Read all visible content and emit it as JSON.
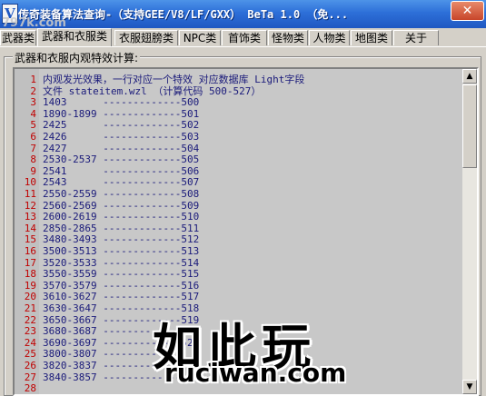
{
  "window": {
    "title": "传奇装备算法查询-（支持GEE/V8/LF/GXX）        BeTa 1.0 （免...",
    "close_label": "✕",
    "app_icon_letter": "V"
  },
  "tabs": [
    {
      "label": "武器类"
    },
    {
      "label": "武器和衣服类"
    },
    {
      "label": "衣服翅膀类"
    },
    {
      "label": "NPC类"
    },
    {
      "label": "首饰类"
    },
    {
      "label": "怪物类"
    },
    {
      "label": "人物类"
    },
    {
      "label": "地图类"
    },
    {
      "label": "关于"
    }
  ],
  "group": {
    "label": "武器和衣服内观特效计算:"
  },
  "editor": {
    "lines": [
      {
        "num": "1",
        "text": "内观发光效果，一行对应一个特效 对应数据库 Light字段"
      },
      {
        "num": "2",
        "text": "文件 stateitem.wzl （计算代码 500-527）"
      },
      {
        "num": "3",
        "text": "1403      -------------500"
      },
      {
        "num": "4",
        "text": "1890-1899 -------------501"
      },
      {
        "num": "5",
        "text": "2425      -------------502"
      },
      {
        "num": "6",
        "text": "2426      -------------503"
      },
      {
        "num": "7",
        "text": "2427      -------------504"
      },
      {
        "num": "8",
        "text": "2530-2537 -------------505"
      },
      {
        "num": "9",
        "text": "2541      -------------506"
      },
      {
        "num": "10",
        "text": "2543      -------------507"
      },
      {
        "num": "11",
        "text": "2550-2559 -------------508"
      },
      {
        "num": "12",
        "text": "2560-2569 -------------509"
      },
      {
        "num": "13",
        "text": "2600-2619 -------------510"
      },
      {
        "num": "14",
        "text": "2850-2865 -------------511"
      },
      {
        "num": "15",
        "text": "3480-3493 -------------512"
      },
      {
        "num": "16",
        "text": "3500-3513 -------------513"
      },
      {
        "num": "17",
        "text": "3520-3533 -------------514"
      },
      {
        "num": "18",
        "text": "3550-3559 -------------515"
      },
      {
        "num": "19",
        "text": "3570-3579 -------------516"
      },
      {
        "num": "20",
        "text": "3610-3627 -------------517"
      },
      {
        "num": "21",
        "text": "3630-3647 -------------518"
      },
      {
        "num": "22",
        "text": "3650-3667 -------------519"
      },
      {
        "num": "23",
        "text": "3680-3687 -------------520"
      },
      {
        "num": "24",
        "text": "3690-3697 -------------521"
      },
      {
        "num": "25",
        "text": "3800-3807 -------------"
      },
      {
        "num": "26",
        "text": "3820-3837 -------------"
      },
      {
        "num": "27",
        "text": "3840-3857 -------------"
      },
      {
        "num": "28",
        "text": ""
      }
    ]
  },
  "scrollbar": {
    "up_arrow": "▲",
    "down_arrow": "▼"
  },
  "watermarks": {
    "small": "797k.com",
    "big": "如此玩",
    "url": "ruciwan.com"
  }
}
